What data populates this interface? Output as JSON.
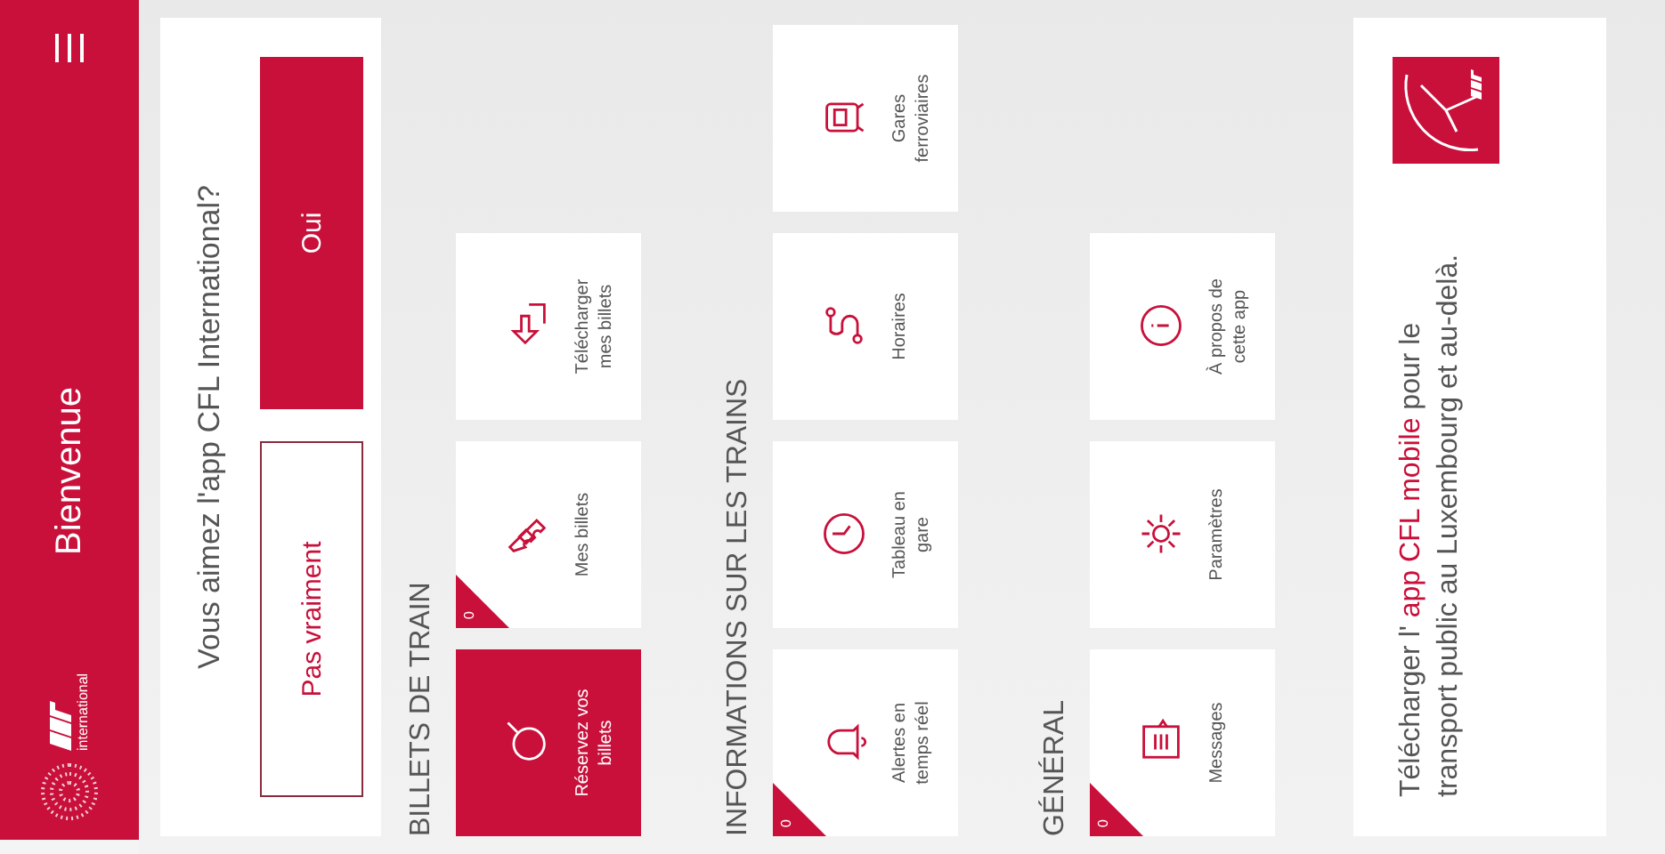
{
  "header": {
    "brand_text": "international",
    "title": "Bienvenue"
  },
  "rating": {
    "question": "Vous aimez l'app CFL International?",
    "buttons": [
      {
        "label": "Pas vraiment",
        "kind": "secondary"
      },
      {
        "label": "Oui",
        "kind": "primary"
      }
    ]
  },
  "sections": [
    {
      "title": "BILLETS DE TRAIN",
      "tiles": [
        {
          "label": "Réservez vos billets",
          "kind": "primary"
        },
        {
          "label": "Mes billets",
          "kind": "default",
          "badge": "0"
        },
        {
          "label": "Télécharger mes billets",
          "kind": "default"
        }
      ]
    },
    {
      "title": "INFORMATIONS SUR LES TRAINS",
      "tiles": [
        {
          "label": "Alertes en temps réel",
          "kind": "default",
          "badge": "0"
        },
        {
          "label": "Tableau en gare",
          "kind": "default"
        },
        {
          "label": "Horaires",
          "kind": "default"
        },
        {
          "label": "Gares ferroviaires",
          "kind": "default"
        }
      ]
    },
    {
      "title": "GÉNÉRAL",
      "tiles": [
        {
          "label": "Messages",
          "kind": "default",
          "badge": "0"
        },
        {
          "label": "Paramètres",
          "kind": "default"
        },
        {
          "label": "À propos de cette app",
          "kind": "default"
        }
      ]
    }
  ],
  "promo": {
    "text": "Télécharger l' **app CFL mobile** pour le transport public au Luxembourg et au-delà."
  }
}
